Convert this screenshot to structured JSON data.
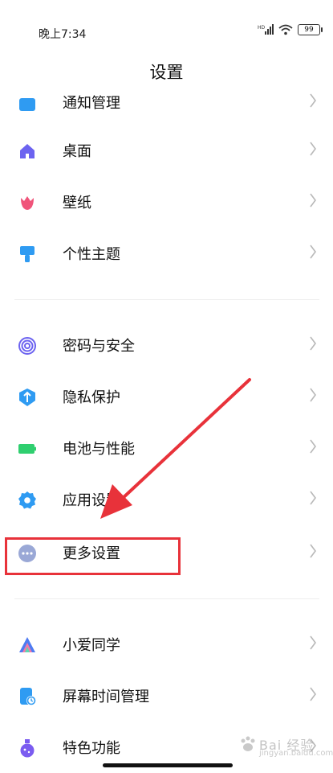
{
  "status_bar": {
    "time": "晚上7:34",
    "battery": "99"
  },
  "page": {
    "title": "设置"
  },
  "settings": {
    "items": [
      {
        "label": "通知管理",
        "icon": "notification-icon",
        "color": "#2f9bf2"
      },
      {
        "label": "桌面",
        "icon": "home-icon",
        "color": "#6c63f0"
      },
      {
        "label": "壁纸",
        "icon": "tulip-icon",
        "color": "#f0547a"
      },
      {
        "label": "个性主题",
        "icon": "paint-brush-icon",
        "color": "#2f9bf2"
      },
      {
        "label": "密码与安全",
        "icon": "fingerprint-icon",
        "color": "#6c63f0"
      },
      {
        "label": "隐私保护",
        "icon": "privacy-shield-icon",
        "color": "#2f9bf2"
      },
      {
        "label": "电池与性能",
        "icon": "battery-icon",
        "color": "#2fcf6f"
      },
      {
        "label": "应用设置",
        "icon": "gear-icon",
        "color": "#2f9bf2"
      },
      {
        "label": "更多设置",
        "icon": "more-dots-icon",
        "color": "#9aa8d6"
      },
      {
        "label": "小爱同学",
        "icon": "xiaoai-icon",
        "color": "#4e7bf2"
      },
      {
        "label": "屏幕时间管理",
        "icon": "screen-time-icon",
        "color": "#2f9bf2"
      },
      {
        "label": "特色功能",
        "icon": "flask-icon",
        "color": "#7b5cf0"
      }
    ]
  },
  "watermark": {
    "text": "Bai 经验",
    "sub": "jingyan.baidu.com"
  },
  "colors": {
    "annotation": "#e8323a",
    "chevron": "#b8b8b8"
  }
}
